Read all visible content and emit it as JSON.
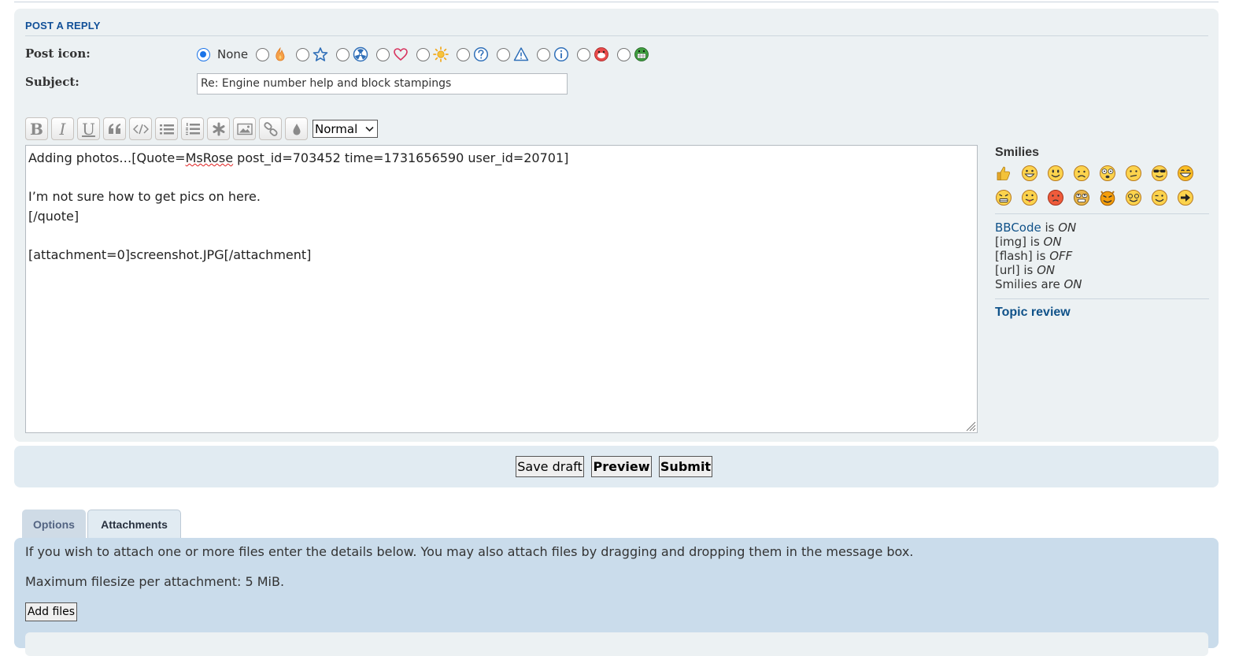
{
  "post_panel": {
    "title": "POST A REPLY",
    "post_icon_label": "Post icon:",
    "post_icon_none_label": "None",
    "post_icons": [
      "flame-icon",
      "star-icon",
      "radioactive-icon",
      "heart-icon",
      "sun-icon",
      "question-icon",
      "warning-icon",
      "info-icon",
      "mrgreen-red-icon",
      "mrgreen-icon"
    ],
    "selected_icon": "None",
    "subject_label": "Subject:",
    "subject_value": "Re: Engine number help and block stampings"
  },
  "toolbar": {
    "buttons": [
      "bold",
      "italic",
      "underline",
      "quote",
      "code",
      "list-bullet",
      "list-numbered",
      "list-item",
      "image",
      "url",
      "color"
    ],
    "font_size_value": "Normal",
    "bold_glyph": "B",
    "italic_glyph": "I",
    "underline_glyph": "U"
  },
  "editor": {
    "line1_prefix": "Adding photos…[Quote=",
    "line1_spell": "MsRose",
    "line1_suffix": " post_id=703452 time=1731656590 user_id=20701]",
    "line3": "I’m not sure how to get pics on here.",
    "line4": "[/quote]",
    "line6": "[attachment=0]screenshot.JPG[/attachment]"
  },
  "sidebar": {
    "smilies_title": "Smilies",
    "smilies": [
      "thumbs-up",
      "grin",
      "smile",
      "sad",
      "eek",
      "confused",
      "cool",
      "laughing",
      "mad",
      "razz",
      "red-face",
      "eyes",
      "evil",
      "mrgreen-glasses",
      "wink",
      "arrow"
    ],
    "bbcode_link": "BBCode",
    "bbcode_is": " is ",
    "bbcode_state": "ON",
    "img_label": "[img] is ",
    "img_state": "ON",
    "flash_label": "[flash] is ",
    "flash_state": "OFF",
    "url_label": "[url] is ",
    "url_state": "ON",
    "smilies_label": "Smilies are ",
    "smilies_state": "ON",
    "topic_review": "Topic review"
  },
  "submit_panel": {
    "save_draft": "Save draft",
    "preview": "Preview",
    "submit": "Submit"
  },
  "tabs": {
    "options": "Options",
    "attachments": "Attachments",
    "active": "Attachments"
  },
  "attachments": {
    "info_text": "If you wish to attach one or more files enter the details below. You may also attach files by dragging and dropping them in the message box.",
    "max_size_text": "Maximum filesize per attachment: 5 MiB.",
    "add_files": "Add files"
  },
  "colors": {
    "link_blue": "#105289",
    "panel_bg": "#ecf1f3",
    "submit_bg": "#e1ebf2",
    "attach_bg": "#cadceb"
  }
}
